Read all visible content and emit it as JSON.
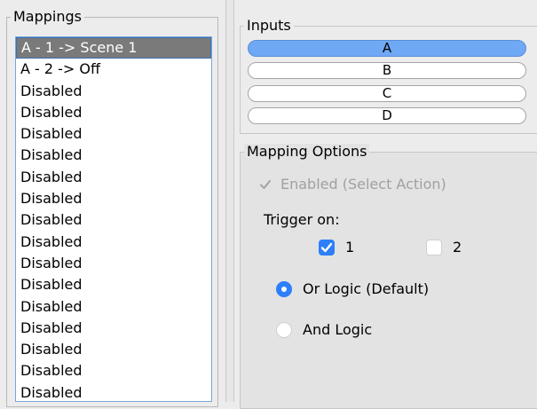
{
  "mappings": {
    "legend": "Mappings",
    "items": [
      "A - 1 -> Scene 1",
      "A - 2 -> Off",
      "Disabled",
      "Disabled",
      "Disabled",
      "Disabled",
      "Disabled",
      "Disabled",
      "Disabled",
      "Disabled",
      "Disabled",
      "Disabled",
      "Disabled",
      "Disabled",
      "Disabled",
      "Disabled",
      "Disabled"
    ],
    "selected_index": 0
  },
  "inputs": {
    "legend": "Inputs",
    "buttons": [
      "A",
      "B",
      "C",
      "D"
    ],
    "active": "A"
  },
  "mapping_options": {
    "legend": "Mapping Options",
    "enabled_label": "Enabled (Select Action)",
    "enabled_checked": true,
    "enabled_disabled": true,
    "trigger_label": "Trigger on:",
    "trigger_1_label": "1",
    "trigger_1_checked": true,
    "trigger_2_label": "2",
    "trigger_2_checked": false,
    "or_logic_label": "Or Logic (Default)",
    "and_logic_label": "And Logic",
    "selected_logic": "or"
  },
  "colors": {
    "accent": "#2d7ff9",
    "selected_input": "#6fa8f5",
    "selected_list_row": "#7a7a7a"
  }
}
